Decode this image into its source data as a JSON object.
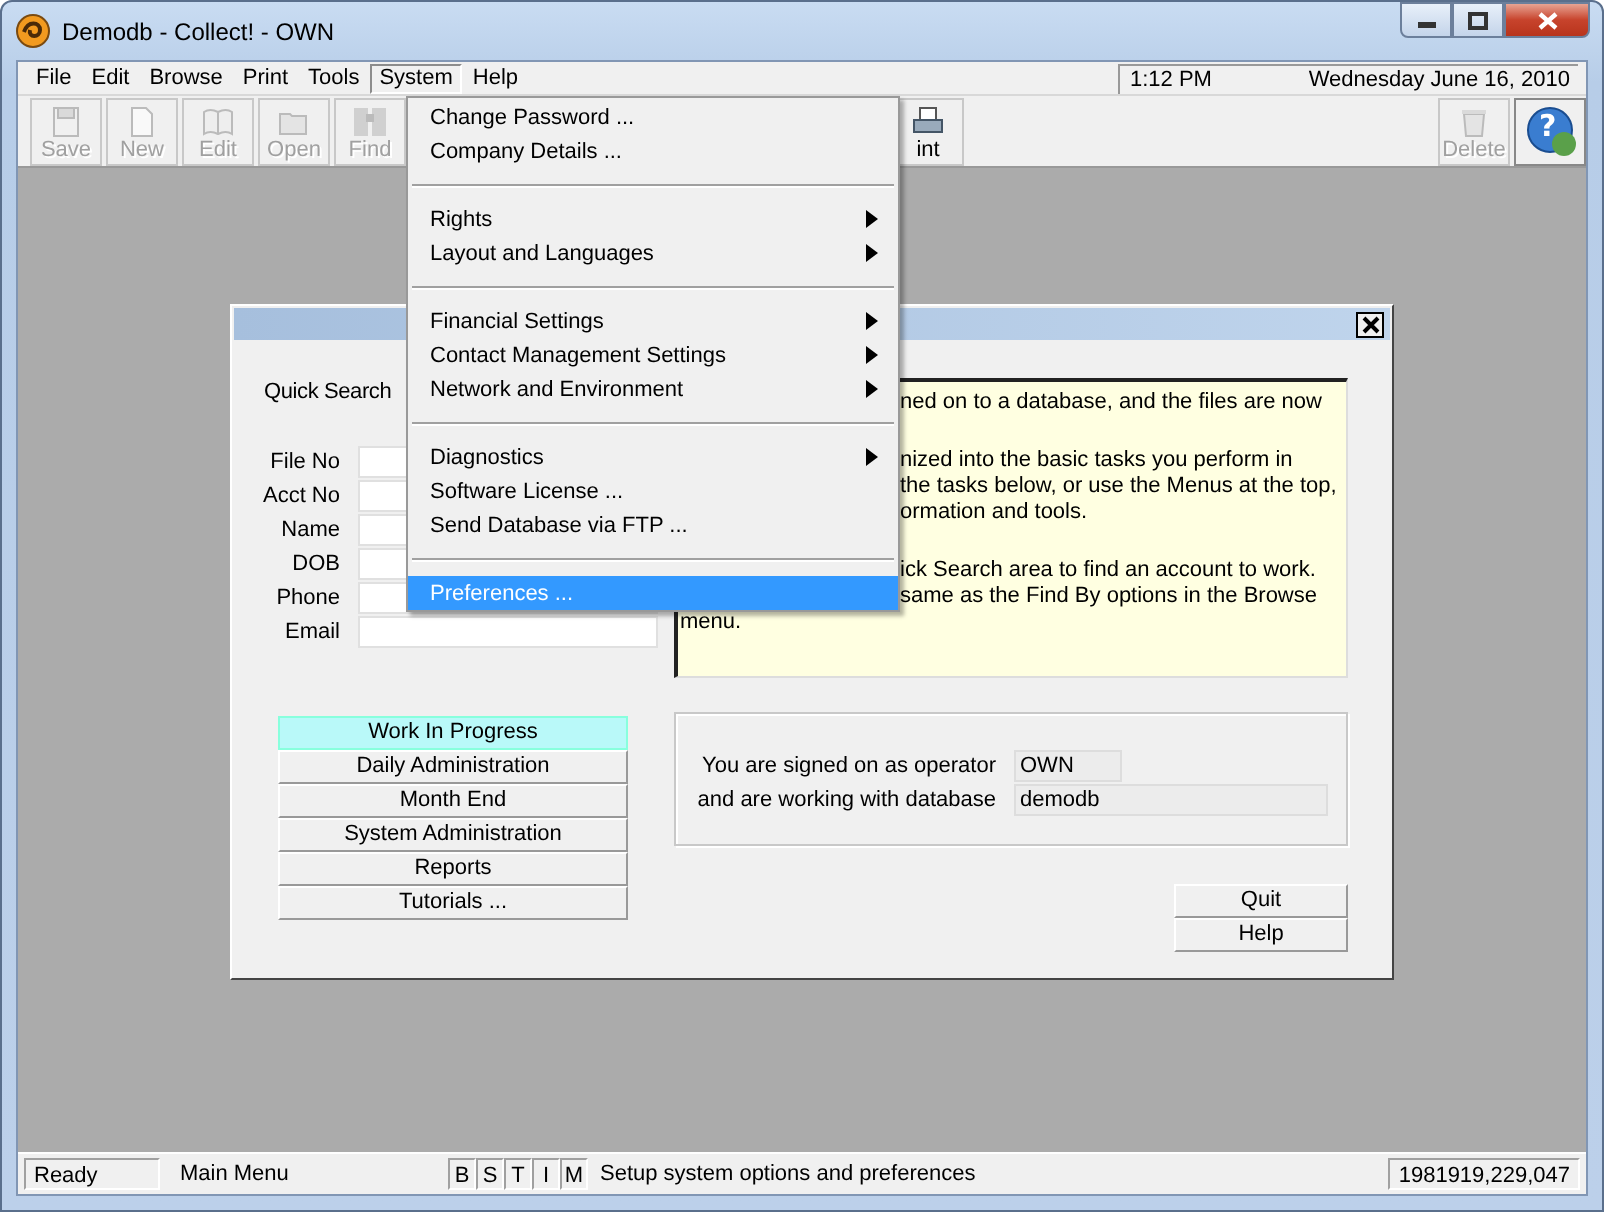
{
  "window": {
    "title": "Demodb - Collect! - OWN"
  },
  "menu_bar": {
    "items": [
      {
        "label": "File",
        "selected": false
      },
      {
        "label": "Edit",
        "selected": false
      },
      {
        "label": "Browse",
        "selected": false
      },
      {
        "label": "Print",
        "selected": false
      },
      {
        "label": "Tools",
        "selected": false
      },
      {
        "label": "System",
        "selected": true
      },
      {
        "label": "Help",
        "selected": false
      }
    ],
    "time": "1:12 PM",
    "date": "Wednesday  June 16, 2010"
  },
  "toolbar": {
    "left": [
      {
        "kind": "save",
        "label": "Save",
        "disabled": true
      },
      {
        "kind": "new",
        "label": "New",
        "disabled": true
      },
      {
        "kind": "edit",
        "label": "Edit",
        "disabled": true
      },
      {
        "kind": "open",
        "label": "Open",
        "disabled": true
      },
      {
        "kind": "find",
        "label": "Find",
        "disabled": true
      }
    ],
    "middle": [
      {
        "kind": "print",
        "label": "int",
        "disabled": false
      }
    ],
    "right": [
      {
        "kind": "delete",
        "label": "Delete",
        "disabled": true
      },
      {
        "kind": "help",
        "glyph": "?",
        "disabled": false
      }
    ]
  },
  "system_menu": {
    "groups": [
      {
        "items": [
          {
            "label": "Change Password ...",
            "submenu": false,
            "selected": false
          },
          {
            "label": "Company Details ...",
            "submenu": false,
            "selected": false
          }
        ]
      },
      {
        "items": [
          {
            "label": "Rights",
            "submenu": true,
            "selected": false
          },
          {
            "label": "Layout and Languages",
            "submenu": true,
            "selected": false
          }
        ]
      },
      {
        "items": [
          {
            "label": "Financial Settings",
            "submenu": true,
            "selected": false
          },
          {
            "label": "Contact Management Settings",
            "submenu": true,
            "selected": false
          },
          {
            "label": "Network and Environment",
            "submenu": true,
            "selected": false
          }
        ]
      },
      {
        "items": [
          {
            "label": "Diagnostics",
            "submenu": true,
            "selected": false
          },
          {
            "label": "Software License ...",
            "submenu": false,
            "selected": false
          },
          {
            "label": "Send Database via FTP ...",
            "submenu": false,
            "selected": false
          }
        ]
      },
      {
        "items": [
          {
            "label": "Preferences ...",
            "submenu": false,
            "selected": true
          }
        ]
      }
    ]
  },
  "dialog": {
    "quick_search": {
      "label": "Quick Search",
      "fields": [
        {
          "label": "File No"
        },
        {
          "label": "Acct No"
        },
        {
          "label": "Name"
        },
        {
          "label": "DOB"
        },
        {
          "label": "Phone"
        },
        {
          "label": "Email"
        }
      ]
    },
    "info_panel": {
      "paragraphs": [
        {
          "lines": [
            {
              "kind": "clipped",
              "text": "ned on to a database, and the files are now"
            }
          ]
        },
        {
          "lines": [
            {
              "kind": "clipped",
              "text": "nized into the basic tasks you perform in"
            },
            {
              "kind": "clipped",
              "text": "the tasks below, or use the Menus at the top,"
            },
            {
              "kind": "clipped",
              "text": "ormation and tools."
            }
          ]
        },
        {
          "lines": [
            {
              "kind": "clipped",
              "text": "ick Search area to find an account to work."
            },
            {
              "kind": "clipped",
              "text": "same as the Find By options in the Browse"
            },
            {
              "kind": "plain",
              "text": "menu."
            }
          ]
        }
      ]
    },
    "nav_buttons": [
      {
        "label": "Work In Progress",
        "selected": true
      },
      {
        "label": "Daily Administration",
        "selected": false
      },
      {
        "label": "Month End",
        "selected": false
      },
      {
        "label": "System Administration",
        "selected": false
      },
      {
        "label": "Reports",
        "selected": false
      },
      {
        "label": "Tutorials ...",
        "selected": false
      }
    ],
    "signon": {
      "operator_label": "You are signed on as operator",
      "operator": "OWN",
      "database_label": "and are working with database",
      "database": "demodb"
    },
    "buttons": [
      "Quit",
      "Help"
    ]
  },
  "status_bar": {
    "state": "Ready",
    "screen": "Main Menu",
    "flags": [
      "B",
      "S",
      "T",
      "I",
      "M"
    ],
    "message": "Setup system options and preferences",
    "counter": "1981919,229,047"
  }
}
